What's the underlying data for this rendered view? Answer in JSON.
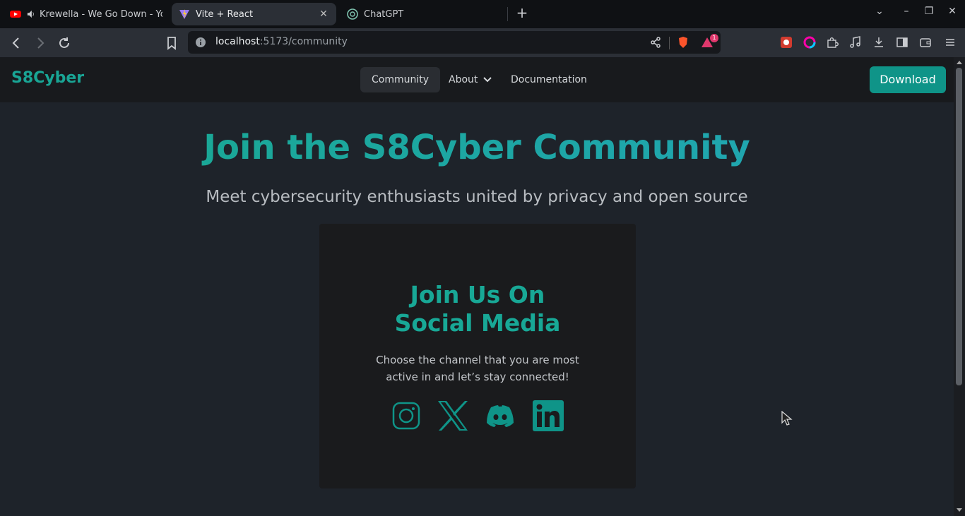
{
  "browser": {
    "tabs": [
      {
        "title": "Krewella - We Go Down - YouT",
        "icon": "youtube-icon"
      },
      {
        "title": "Vite + React",
        "icon": "vite-icon"
      },
      {
        "title": "ChatGPT",
        "icon": "chatgpt-icon"
      }
    ],
    "url_host": "localhost",
    "url_path": ":5173/community",
    "notification_count": "1"
  },
  "app": {
    "logo": "S8Cyber",
    "nav": {
      "community": "Community",
      "about": "About",
      "documentation": "Documentation"
    },
    "download_label": "Download"
  },
  "hero": {
    "title": "Join the S8Cyber Community",
    "subtitle": "Meet cybersecurity enthusiasts united by privacy and open source"
  },
  "card": {
    "title_line1": "Join Us On",
    "title_line2": "Social Media",
    "text_line1": "Choose the channel that you are most",
    "text_line2": "active in and let’s stay connected!",
    "socials": [
      "instagram-icon",
      "x-icon",
      "discord-icon",
      "linkedin-icon"
    ]
  },
  "colors": {
    "accent": "#0f9488",
    "title_gradient_start": "#18a88e",
    "title_gradient_end": "#22a5b8",
    "page_bg": "#1e232a",
    "card_bg": "#1a1b1d"
  }
}
